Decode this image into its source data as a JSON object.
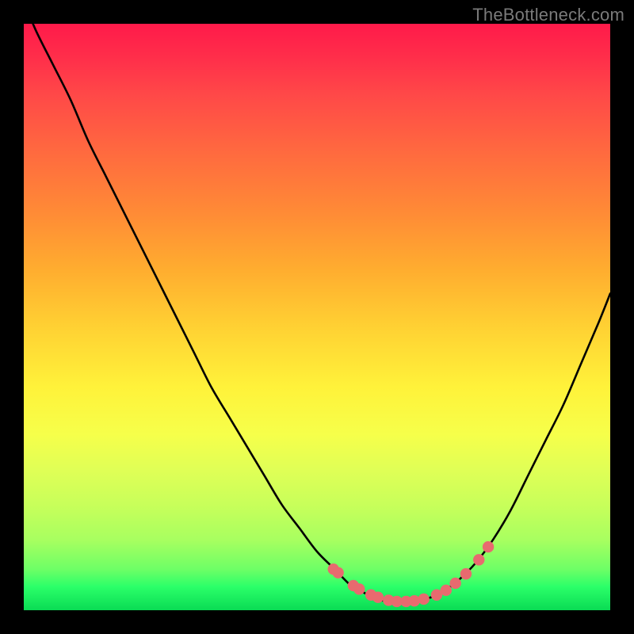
{
  "attribution": "TheBottleneck.com",
  "colors": {
    "marker": "#e86a6f",
    "curve": "#000000",
    "background_top": "#ff1a4a",
    "background_bottom": "#0adb54"
  },
  "chart_data": {
    "type": "line",
    "title": "",
    "xlabel": "",
    "ylabel": "",
    "xlim": [
      0,
      100
    ],
    "ylim": [
      0,
      100
    ],
    "grid": false,
    "legend": false,
    "note": "Values read from plot by estimating against the 740x740 gradient area. y=100 is top (red), y=0 is bottom (green). Curve represents bottleneck severity; markers indicate near-optimal region (low bottleneck).",
    "x": [
      0,
      2,
      5,
      8,
      11,
      14,
      17,
      20,
      23,
      26,
      29,
      32,
      35,
      38,
      41,
      44,
      47,
      50,
      53,
      56,
      58,
      60,
      62,
      64,
      66,
      68,
      70,
      72,
      74,
      77,
      80,
      83,
      86,
      89,
      92,
      95,
      98,
      100
    ],
    "y": [
      104,
      99,
      93,
      87,
      80,
      74,
      68,
      62,
      56,
      50,
      44,
      38,
      33,
      28,
      23,
      18,
      14,
      10,
      7,
      4,
      3,
      2,
      1.5,
      1.5,
      1.5,
      1.8,
      2.4,
      3.5,
      5,
      8,
      12,
      17,
      23,
      29,
      35,
      42,
      49,
      54
    ],
    "markers_x": [
      52.8,
      53.6,
      56.2,
      57.2,
      59.2,
      60.4,
      62.2,
      63.6,
      65.2,
      66.6,
      68.2,
      70.4,
      72.0,
      73.6,
      75.4,
      77.6,
      79.2
    ],
    "markers_y": [
      7.0,
      6.4,
      4.2,
      3.6,
      2.6,
      2.2,
      1.7,
      1.5,
      1.5,
      1.6,
      1.9,
      2.6,
      3.4,
      4.6,
      6.2,
      8.6,
      10.8
    ]
  }
}
